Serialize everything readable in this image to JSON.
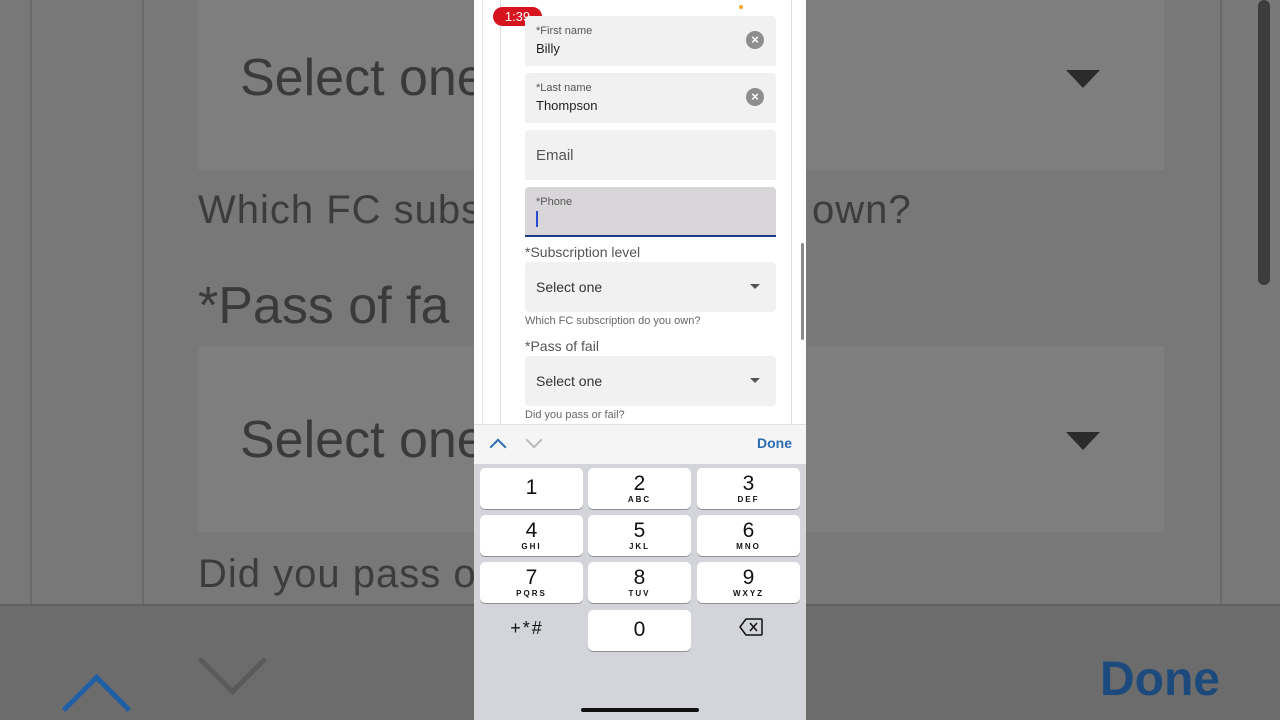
{
  "status": {
    "time": "1:39"
  },
  "form": {
    "first_name": {
      "label": "*First name",
      "value": "Billy"
    },
    "last_name": {
      "label": "*Last name",
      "value": "Thompson"
    },
    "email": {
      "placeholder": "Email"
    },
    "phone": {
      "label": "*Phone",
      "value": ""
    },
    "subscription": {
      "label": "*Subscription level",
      "selected": "Select one",
      "helper": "Which FC subscription do you own?"
    },
    "pass_fail": {
      "label": "*Pass of fail",
      "selected": "Select one",
      "helper": "Did you pass or fail?"
    }
  },
  "accessory": {
    "done": "Done"
  },
  "keypad": {
    "keys": [
      {
        "num": "1",
        "letters": ""
      },
      {
        "num": "2",
        "letters": "ABC"
      },
      {
        "num": "3",
        "letters": "DEF"
      },
      {
        "num": "4",
        "letters": "GHI"
      },
      {
        "num": "5",
        "letters": "JKL"
      },
      {
        "num": "6",
        "letters": "MNO"
      },
      {
        "num": "7",
        "letters": "PQRS"
      },
      {
        "num": "8",
        "letters": "TUV"
      },
      {
        "num": "9",
        "letters": "WXYZ"
      },
      {
        "num": "0",
        "letters": ""
      }
    ],
    "symbols": "+*#",
    "delete_icon": "backspace-icon"
  },
  "background": {
    "select_text_1": "Select one",
    "helper_1": "Which FC subs",
    "helper_1_tail": "own?",
    "section_2": "*Pass of fa",
    "select_text_2": "Select one",
    "helper_2": "Did you pass o",
    "done": "Done"
  },
  "colors": {
    "accent": "#2a6db3",
    "badge": "#d6141f",
    "focus": "#1a3c8a"
  }
}
